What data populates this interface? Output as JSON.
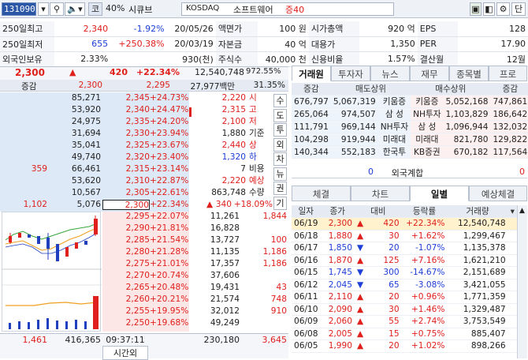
{
  "top": {
    "code": "131090",
    "search_icon": "search-icon",
    "speaker_icon": "speaker-icon",
    "market_badge": "코",
    "margin": "40%",
    "name": "시큐브",
    "market": "KOSDAQ",
    "industry": "소프트웨어",
    "margin_label": "증40",
    "buttons": [
      "window-icon",
      "fill-icon",
      "gear-icon"
    ],
    "help": "단"
  },
  "info": [
    [
      "250일최고",
      "2,340",
      "-1.92%",
      "20/05/26",
      "액면가",
      "100 원",
      "시가총액",
      "920 억",
      "EPS",
      "128"
    ],
    [
      "250일최저",
      "655",
      "+250.38%",
      "20/03/19",
      "자본금",
      "40 억",
      "대용가",
      "1,350",
      "PER",
      "17.90"
    ],
    [
      "외국인보유",
      "2.33%",
      "",
      "930(천)",
      "주식수",
      "40,000 천",
      "신용비율",
      "1.57%",
      "결산월",
      "12월"
    ]
  ],
  "quote": {
    "price": "2,300",
    "change": "420",
    "pct": "+22.34%",
    "volume": "12,540,748",
    "vol_ratio": "972.55%",
    "sub_label": "증감",
    "sub_price": "2,300",
    "sub_price2": "2,295",
    "amount": "27,977백만",
    "amount_pct": "31.35%"
  },
  "asks": [
    {
      "vol": "85,271",
      "price": "2,345",
      "pct": "+24.73%",
      "chg": ""
    },
    {
      "vol": "53,920",
      "price": "2,340",
      "pct": "+24.47%",
      "chg": ""
    },
    {
      "vol": "24,975",
      "price": "2,335",
      "pct": "+24.20%",
      "chg": ""
    },
    {
      "vol": "31,694",
      "price": "2,330",
      "pct": "+23.94%",
      "chg": ""
    },
    {
      "vol": "35,041",
      "price": "2,325",
      "pct": "+23.67%",
      "chg": ""
    },
    {
      "vol": "49,740",
      "price": "2,320",
      "pct": "+23.40%",
      "chg": ""
    },
    {
      "vol": "66,461",
      "price": "2,315",
      "pct": "+23.14%",
      "chg": "359"
    },
    {
      "vol": "53,620",
      "price": "2,310",
      "pct": "+22.87%",
      "chg": ""
    },
    {
      "vol": "10,567",
      "price": "2,305",
      "pct": "+22.61%",
      "chg": ""
    },
    {
      "vol": "5,076",
      "price": "2,300",
      "pct": "+22.34%",
      "chg": "1,102"
    }
  ],
  "bids": [
    {
      "price": "2,295",
      "pct": "+22.07%",
      "vol": "11,261",
      "chg": "1,844"
    },
    {
      "price": "2,290",
      "pct": "+21.81%",
      "vol": "16,828",
      "chg": ""
    },
    {
      "price": "2,285",
      "pct": "+21.54%",
      "vol": "13,727",
      "chg": "100"
    },
    {
      "price": "2,280",
      "pct": "+21.28%",
      "vol": "11,135",
      "chg": "1,186"
    },
    {
      "price": "2,275",
      "pct": "+21.01%",
      "vol": "17,357",
      "chg": "1,186"
    },
    {
      "price": "2,270",
      "pct": "+20.74%",
      "vol": "37,606",
      "chg": ""
    },
    {
      "price": "2,265",
      "pct": "+20.48%",
      "vol": "19,431",
      "chg": "43"
    },
    {
      "price": "2,260",
      "pct": "+20.21%",
      "vol": "21,574",
      "chg": "748"
    },
    {
      "price": "2,255",
      "pct": "+19.95%",
      "vol": "32,012",
      "chg": "910"
    },
    {
      "price": "2,250",
      "pct": "+19.68%",
      "vol": "49,249",
      "chg": ""
    }
  ],
  "side_info": [
    {
      "v": "2,220",
      "k": "시",
      "c": "red"
    },
    {
      "v": "2,315",
      "k": "고",
      "c": "red"
    },
    {
      "v": "2,100",
      "k": "저",
      "c": "red"
    },
    {
      "v": "1,880",
      "k": "기준",
      "c": "blk"
    },
    {
      "v": "2,440",
      "k": "상",
      "c": "red"
    },
    {
      "v": "1,320",
      "k": "하",
      "c": "blue"
    },
    {
      "v": "7",
      "k": "비용",
      "c": "blk"
    },
    {
      "v": "2,220",
      "k": "예상",
      "c": "red"
    },
    {
      "v": "863,748",
      "k": "수량",
      "c": "blk"
    }
  ],
  "expected": {
    "arrow": "▲",
    "chg": "340",
    "pct": "+18.09%"
  },
  "vert_buttons": [
    "수",
    "도",
    "투",
    "외",
    "차",
    "뉴",
    "권",
    "기"
  ],
  "totals": {
    "ask_chg": "1,461",
    "ask_vol": "416,365",
    "time": "09:37:11",
    "time_label": "시간외",
    "bid_vol": "230,180",
    "bid_chg": "3,645"
  },
  "broker_tabs": [
    "거래원",
    "투자자",
    "뉴스",
    "재무",
    "종목별",
    "프로"
  ],
  "broker_header": [
    "증감",
    "매도상위",
    "",
    "매수상위",
    "증감"
  ],
  "brokers": [
    [
      "676,797",
      "5,067,319",
      "키움증",
      "키움증",
      "5,052,168",
      "747,861"
    ],
    [
      "265,064",
      "974,507",
      "삼 성",
      "NH투자",
      "1,103,829",
      "186,642"
    ],
    [
      "111,791",
      "969,144",
      "NH투자",
      "삼 성",
      "1,096,944",
      "132,032"
    ],
    [
      "104,298",
      "919,944",
      "미래대",
      "미래대",
      "821,780",
      "129,822"
    ],
    [
      "140,344",
      "552,183",
      "한국투",
      "KB증권",
      "670,182",
      "117,564"
    ]
  ],
  "foreign": {
    "left": "0",
    "label": "외국계합",
    "right": "0"
  },
  "daily_tabs": [
    "체결",
    "차트",
    "일별",
    "예상체결"
  ],
  "daily_header": [
    "일자",
    "종가",
    "대비",
    "등락률",
    "거래량"
  ],
  "daily": [
    {
      "d": "06/19",
      "p": "2,300",
      "dir": "up",
      "c": "420",
      "r": "+22.34%",
      "v": "12,540,748"
    },
    {
      "d": "06/18",
      "p": "1,880",
      "dir": "up",
      "c": "30",
      "r": "+1.62%",
      "v": "1,299,467"
    },
    {
      "d": "06/17",
      "p": "1,850",
      "dir": "down",
      "c": "20",
      "r": "-1.07%",
      "v": "1,135,378"
    },
    {
      "d": "06/16",
      "p": "1,870",
      "dir": "up",
      "c": "125",
      "r": "+7.16%",
      "v": "1,621,210"
    },
    {
      "d": "06/15",
      "p": "1,745",
      "dir": "down",
      "c": "300",
      "r": "-14.67%",
      "v": "2,151,689"
    },
    {
      "d": "06/12",
      "p": "2,045",
      "dir": "down",
      "c": "65",
      "r": "-3.08%",
      "v": "3,421,055"
    },
    {
      "d": "06/11",
      "p": "2,110",
      "dir": "up",
      "c": "20",
      "r": "+0.96%",
      "v": "1,771,359"
    },
    {
      "d": "06/10",
      "p": "2,090",
      "dir": "up",
      "c": "30",
      "r": "+1.46%",
      "v": "1,329,487"
    },
    {
      "d": "06/09",
      "p": "2,060",
      "dir": "up",
      "c": "55",
      "r": "+2.74%",
      "v": "3,753,549"
    },
    {
      "d": "06/08",
      "p": "2,005",
      "dir": "up",
      "c": "15",
      "r": "+0.75%",
      "v": "885,407"
    },
    {
      "d": "06/05",
      "p": "1,990",
      "dir": "up",
      "c": "20",
      "r": "+1.02%",
      "v": "898,266"
    }
  ]
}
